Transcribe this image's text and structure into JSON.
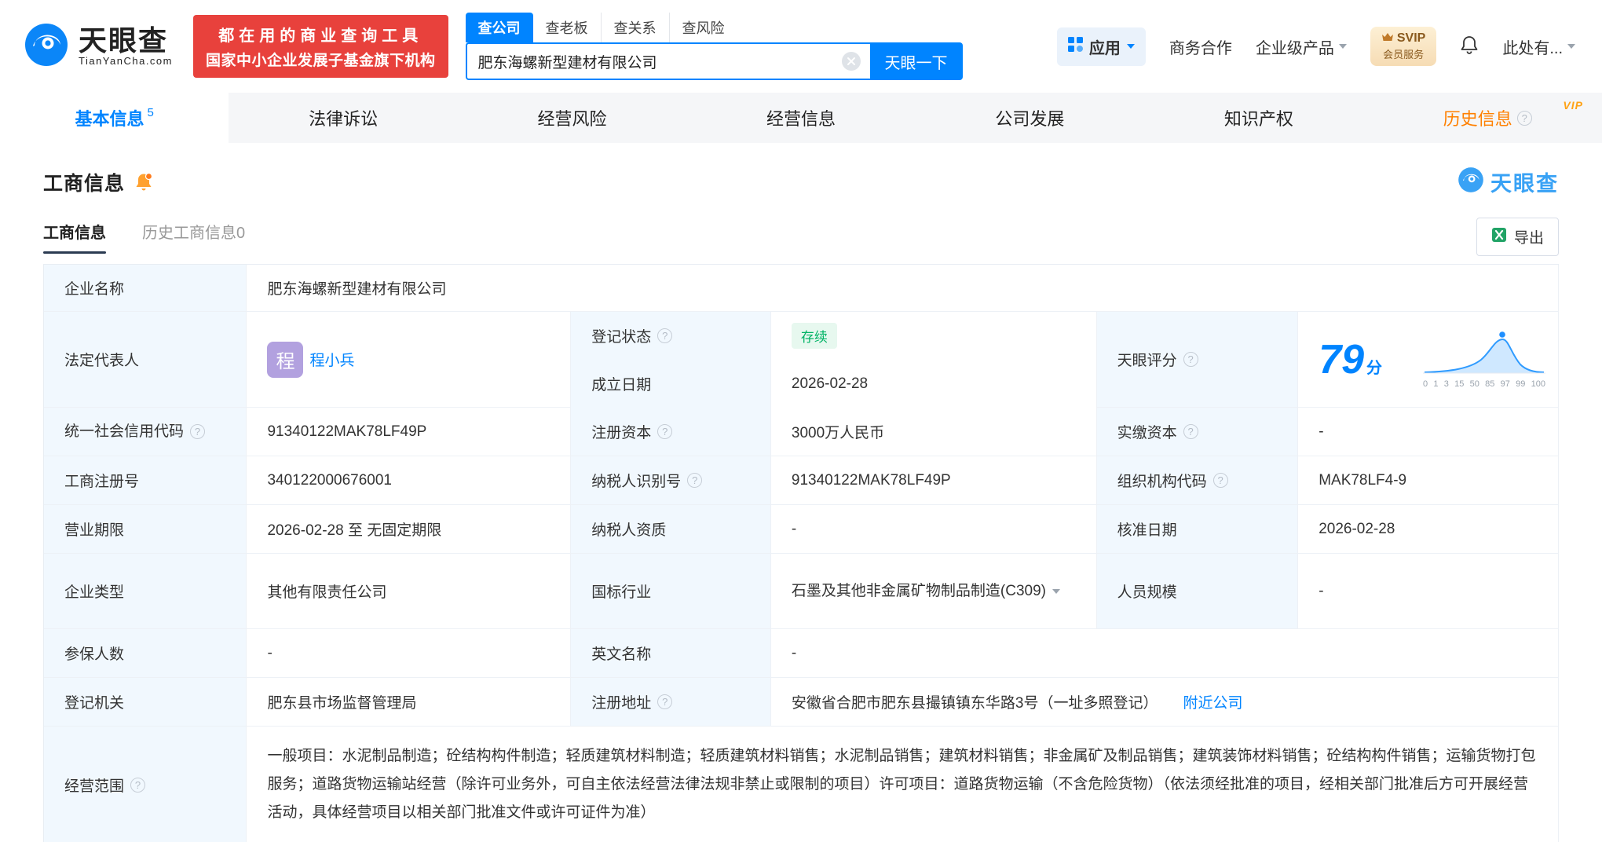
{
  "header": {
    "brand": {
      "name": "天眼查",
      "domain": "TianYanCha.com"
    },
    "promo": {
      "line1": "都在用的商业查询工具",
      "line2": "国家中小企业发展子基金旗下机构"
    },
    "search": {
      "tabs": [
        {
          "label": "查公司"
        },
        {
          "label": "查老板"
        },
        {
          "label": "查关系"
        },
        {
          "label": "查风险"
        }
      ],
      "value": "肥东海螺新型建材有限公司",
      "button": "天眼一下"
    },
    "menu": {
      "apps": "应用",
      "coop": "商务合作",
      "enterprise": "企业级产品",
      "svip_top": "SVIP",
      "svip_bottom": "会员服务",
      "account": "此处有..."
    }
  },
  "nav": {
    "tabs": [
      {
        "label": "基本信息",
        "badge": "5"
      },
      {
        "label": "法律诉讼"
      },
      {
        "label": "经营风险"
      },
      {
        "label": "经营信息"
      },
      {
        "label": "公司发展"
      },
      {
        "label": "知识产权"
      },
      {
        "label": "历史信息"
      }
    ],
    "vip": "VIP"
  },
  "section": {
    "title": "工商信息",
    "watermark": "天眼查",
    "subtab_active": "工商信息",
    "subtab_history": "历史工商信息",
    "subtab_history_count": "0",
    "export": "导出"
  },
  "icons": {
    "help": "?"
  },
  "table": {
    "company_name_label": "企业名称",
    "company_name": "肥东海螺新型建材有限公司",
    "legal_rep_label": "法定代表人",
    "legal_rep_avatar": "程",
    "legal_rep": "程小兵",
    "reg_status_label": "登记状态",
    "reg_status": "存续",
    "est_date_label": "成立日期",
    "est_date": "2026-02-28",
    "score_label": "天眼评分",
    "score": "79",
    "score_unit": "分",
    "score_axis": [
      "0",
      "1",
      "3",
      "15",
      "50",
      "85",
      "97",
      "99",
      "100"
    ],
    "credit_code_label": "统一社会信用代码",
    "credit_code": "91340122MAK78LF49P",
    "reg_capital_label": "注册资本",
    "reg_capital": "3000万人民币",
    "paid_capital_label": "实缴资本",
    "paid_capital": "-",
    "reg_number_label": "工商注册号",
    "reg_number": "340122000676001",
    "taxpayer_id_label": "纳税人识别号",
    "taxpayer_id": "91340122MAK78LF49P",
    "org_code_label": "组织机构代码",
    "org_code": "MAK78LF4-9",
    "business_term_label": "营业期限",
    "business_term": "2026-02-28 至 无固定期限",
    "taxpayer_quality_label": "纳税人资质",
    "taxpayer_quality": "-",
    "approval_date_label": "核准日期",
    "approval_date": "2026-02-28",
    "company_type_label": "企业类型",
    "company_type": "其他有限责任公司",
    "industry_label": "国标行业",
    "industry": "石墨及其他非金属矿物制品制造",
    "industry_code": "(C309)",
    "staff_size_label": "人员规模",
    "staff_size": "-",
    "insured_label": "参保人数",
    "insured": "-",
    "english_name_label": "英文名称",
    "english_name": "-",
    "reg_authority_label": "登记机关",
    "reg_authority": "肥东县市场监督管理局",
    "address_label": "注册地址",
    "address": "安徽省合肥市肥东县撮镇镇东华路3号（一址多照登记）",
    "nearby": "附近公司",
    "scope_label": "经营范围",
    "scope": "一般项目：水泥制品制造；砼结构构件制造；轻质建筑材料制造；轻质建筑材料销售；水泥制品销售；建筑材料销售；非金属矿及制品销售；建筑装饰材料销售；砼结构构件销售；运输货物打包服务；道路货物运输站经营（除许可业务外，可自主依法经营法律法规非禁止或限制的项目）许可项目：道路货物运输（不含危险货物）（依法须经批准的项目，经相关部门批准后方可开展经营活动，具体经营项目以相关部门批准文件或许可证件为准）"
  }
}
